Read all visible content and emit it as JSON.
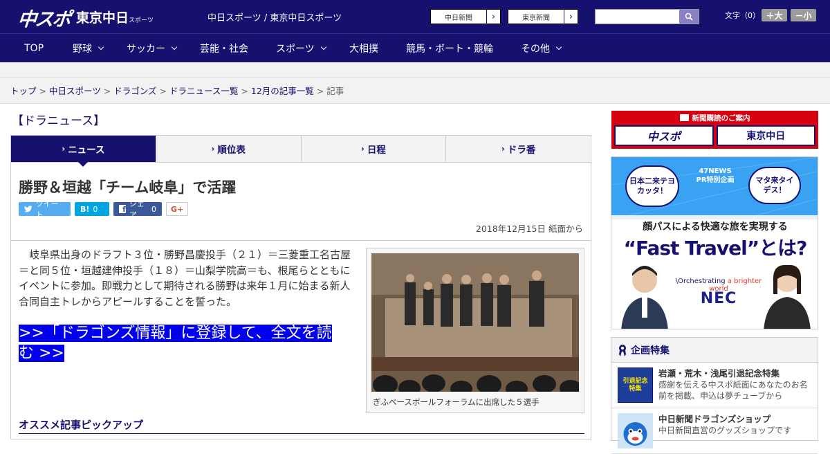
{
  "header": {
    "logo_main": "中スポ",
    "logo_sub": "東京中日",
    "logo_sub_small": "スポーツ",
    "site_title": "中日スポーツ / 東京中日スポーツ",
    "paper_links": [
      "中日新聞",
      "東京新聞"
    ],
    "search_placeholder": "",
    "font_size_label": "文字（0）",
    "font_bigger": "＋大",
    "font_smaller": "－小"
  },
  "nav": {
    "items": [
      {
        "label": "TOP",
        "dropdown": false
      },
      {
        "label": "野球",
        "dropdown": true
      },
      {
        "label": "サッカー",
        "dropdown": true
      },
      {
        "label": "芸能・社会",
        "dropdown": false
      },
      {
        "label": "スポーツ",
        "dropdown": true
      },
      {
        "label": "大相撲",
        "dropdown": false
      },
      {
        "label": "競馬・ボート・競輪",
        "dropdown": false
      },
      {
        "label": "その他",
        "dropdown": true
      }
    ]
  },
  "breadcrumb": {
    "items": [
      "トップ",
      "中日スポーツ",
      "ドラゴンズ",
      "ドラニュース一覧",
      "12月の記事一覧"
    ],
    "current": "記事",
    "separator": ">"
  },
  "section": {
    "title": "【ドラニュース】",
    "tabs": [
      "ニュース",
      "順位表",
      "日程",
      "ドラ番"
    ],
    "active_tab": 0
  },
  "article": {
    "headline": "勝野＆垣越「チーム岐阜」で活躍",
    "share": {
      "tweet": "ツイート",
      "hatena_label": "B!",
      "hatena_count": "0",
      "facebook": "シェア",
      "facebook_count": "0",
      "gplus": "G+"
    },
    "date": "2018年12月15日 紙面から",
    "body": "岐阜県出身のドラフト３位・勝野昌慶投手（２１）＝三菱重工名古屋＝と同５位・垣越建伸投手（１８）＝山梨学院高＝も、根尾らとともにイベントに参加。即戦力として期待される勝野は来年１月に始まる新人合同自主トレからアピールすることを誓った。",
    "cta": ">>「ドラゴンズ情報」に登録して、全文を読む >>",
    "photo_caption": "ぎふベースボールフォーラムに出席した５選手",
    "picks_title": "オススメ記事ピックアップ"
  },
  "sidebar": {
    "subscription": {
      "heading": "新聞購読のご案内",
      "logo1": "中スポ",
      "logo2": "東京中日"
    },
    "ad": {
      "bubble1": "日本二来テヨカッタ！",
      "badge_top": "47NEWS",
      "badge_bottom": "PR特別企画",
      "bubble2": "マタ来タイデス！",
      "headline": "顔パスによる快適な旅を実現する",
      "big": "“Fast Travel”とは?",
      "tagline_brand": "\\Orchestrating",
      "tagline_rest": "a brighter world",
      "brand": "NEC"
    },
    "features": {
      "title": "企画特集",
      "items": [
        {
          "title": "岩瀬・荒木・浅尾引退記念特集",
          "desc": "感謝を伝える中スポ紙面にあなたのお名前を掲載、申込は夢チューブから",
          "thumb": "引退記念特集"
        },
        {
          "title": "中日新聞ドラゴンズショップ",
          "desc": "中日新聞直営のグッズショップです",
          "thumb": ""
        }
      ]
    }
  },
  "colors": {
    "brand_navy": "#16106e",
    "cta_blue": "#0000ee",
    "subscription_red": "#d7000f"
  }
}
